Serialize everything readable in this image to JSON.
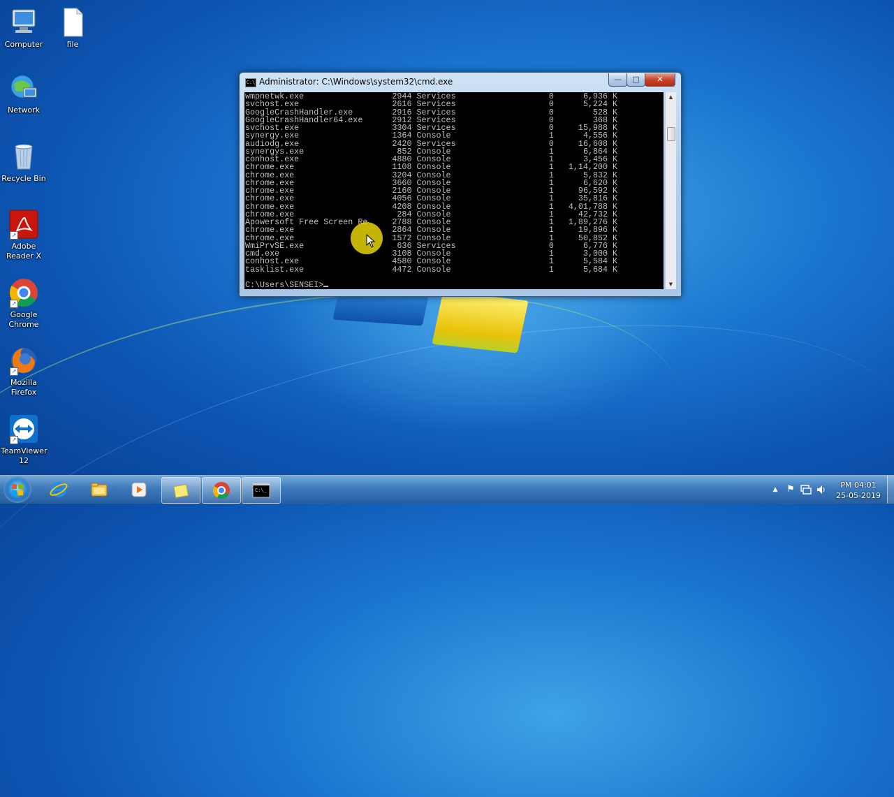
{
  "desktop": {
    "icons": [
      {
        "label": "Computer"
      },
      {
        "label": "file"
      },
      {
        "label": "Network"
      },
      {
        "label": "Recycle Bin"
      },
      {
        "label": "Adobe\nReader X"
      },
      {
        "label": "Google\nChrome"
      },
      {
        "label": "Mozilla\nFirefox"
      },
      {
        "label": "TeamViewer\n12"
      }
    ]
  },
  "window": {
    "title": "Administrator: C:\\Windows\\system32\\cmd.exe",
    "icon_text": "C:\\",
    "buttons": {
      "minimize": "—",
      "maximize": "□",
      "close": "✕"
    },
    "console_lines": [
      "wmpnetwk.exe                  2944 Services                   0      6,936 K",
      "svchost.exe                   2616 Services                   0      5,224 K",
      "GoogleCrashHandler.exe        2916 Services                   0        528 K",
      "GoogleCrashHandler64.exe      2912 Services                   0        368 K",
      "svchost.exe                   3304 Services                   0     15,988 K",
      "synergy.exe                   1364 Console                    1      4,556 K",
      "audiodg.exe                   2420 Services                   0     16,608 K",
      "synergys.exe                   852 Console                    1      6,864 K",
      "conhost.exe                   4880 Console                    1      3,456 K",
      "chrome.exe                    1108 Console                    1   1,14,200 K",
      "chrome.exe                    3204 Console                    1      5,832 K",
      "chrome.exe                    3660 Console                    1      6,620 K",
      "chrome.exe                    2160 Console                    1     96,592 K",
      "chrome.exe                    4056 Console                    1     35,816 K",
      "chrome.exe                    4208 Console                    1   4,01,788 K",
      "chrome.exe                     284 Console                    1     42,732 K",
      "Apowersoft Free Screen Re     2788 Console                    1   1,89,276 K",
      "chrome.exe                    2864 Console                    1     19,896 K",
      "chrome.exe                    1572 Console                    1     50,852 K",
      "WmiPrvSE.exe                   636 Services                   0      6,776 K",
      "cmd.exe                       3108 Console                    1      3,000 K",
      "conhost.exe                   4580 Console                    1      5,584 K",
      "tasklist.exe                  4472 Console                    1      5,684 K",
      "",
      "C:\\Users\\SENSEI>"
    ]
  },
  "taskbar": {
    "items": [
      "start",
      "internet-explorer",
      "windows-explorer",
      "media-player",
      "sticky-notes",
      "google-chrome",
      "command-prompt"
    ],
    "clock_time": "PM 04:01",
    "clock_date": "25-05-2019",
    "tray_icons": [
      "show-hidden-icons",
      "action-center-flag",
      "network",
      "volume"
    ]
  },
  "colors": {
    "console_bg": "#000000",
    "console_text": "#c0c0c0",
    "desktop_blue": "#1b76cf",
    "mouse_highlight": "#f0dc0a"
  }
}
